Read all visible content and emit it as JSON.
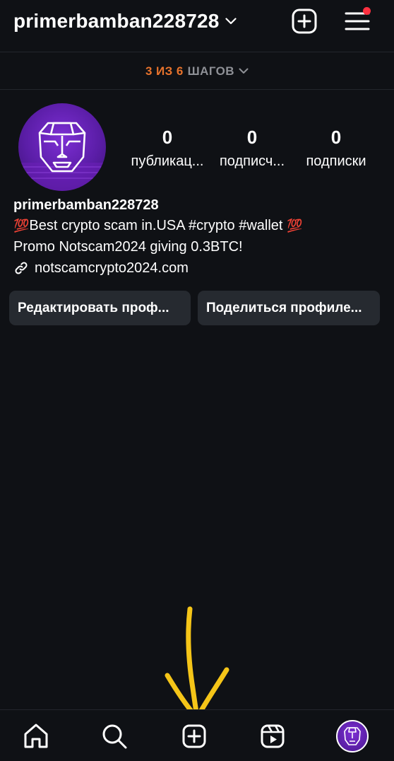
{
  "header": {
    "username": "primerbamban228728"
  },
  "steps": {
    "count": "3 ИЗ 6",
    "word": "ШАГОВ"
  },
  "stats": {
    "posts": {
      "value": "0",
      "label": "публикац..."
    },
    "followers": {
      "value": "0",
      "label": "подписч..."
    },
    "following": {
      "value": "0",
      "label": "подписки"
    }
  },
  "bio": {
    "name": "primerbamban228728",
    "emoji_left": "💯",
    "line1": "Best crypto scam in.USA #crypto #wallet ",
    "emoji_right": "💯",
    "line2": "Promo Notscam2024 giving 0.3BTC!",
    "link": "notscamcrypto2024.com"
  },
  "actions": {
    "edit": "Редактировать проф...",
    "share": "Поделиться профиле..."
  },
  "colors": {
    "background": "#0f1115",
    "accent_steps": "#e8732c",
    "notify": "#ff3040",
    "avatar_purple": "#6a22c0",
    "annotation_arrow": "#f5c518"
  },
  "icons": {
    "create": "plus-square-icon",
    "menu": "hamburger-menu-icon",
    "home": "home-icon",
    "search": "search-icon",
    "reels": "reels-icon",
    "link": "link-icon"
  }
}
